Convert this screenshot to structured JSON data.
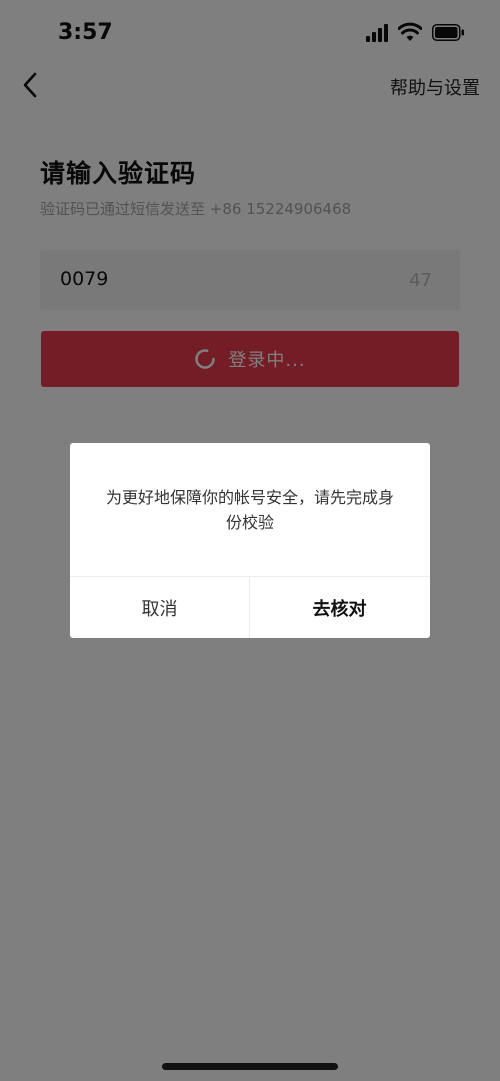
{
  "status_bar": {
    "time": "3:57",
    "icons": [
      "signal-icon",
      "wifi-icon",
      "battery-icon"
    ]
  },
  "nav": {
    "back_icon": "chevron-left-icon",
    "help_label": "帮助与设置"
  },
  "page": {
    "title": "请输入验证码",
    "subtitle": "验证码已通过短信发送至 +86 15224906468"
  },
  "code_input": {
    "value": "0079",
    "countdown": "47"
  },
  "login_button": {
    "label": "登录中...",
    "icon": "loading-spinner-icon",
    "color": "#e83a4f"
  },
  "dialog": {
    "message": "为更好地保障你的帐号安全，请先完成身份校验",
    "cancel_label": "取消",
    "confirm_label": "去核对"
  }
}
